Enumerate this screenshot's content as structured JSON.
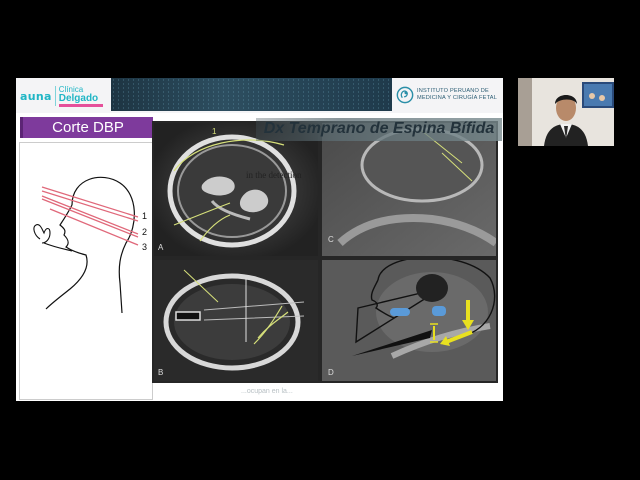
{
  "header": {
    "left_logo": {
      "brand": "auna",
      "clinic_line1": "Clínica",
      "clinic_line2": "Delgado"
    },
    "right_logo": {
      "line1": "INSTITUTO PERUANO DE",
      "line2": "MEDICINA Y CIRUGÍA FETAL"
    }
  },
  "slide": {
    "section_title": "Corte DBP",
    "banner_title": "Dx Temprano de Espina Bífida",
    "diagram_labels": [
      "1",
      "2",
      "3"
    ],
    "panel_labels": [
      "A",
      "B",
      "C",
      "D"
    ],
    "panel_a_number": "1",
    "panel_a_overlay_text": "in the detection",
    "footer_text": "...ocupan en la..."
  },
  "colors": {
    "title_bg": "#7e3a9c",
    "cut_lines": "#e0687a",
    "us_annotation": "#d6e07a",
    "arrow_yellow": "#e8e020",
    "highlight_blue": "#5a9ad8"
  }
}
